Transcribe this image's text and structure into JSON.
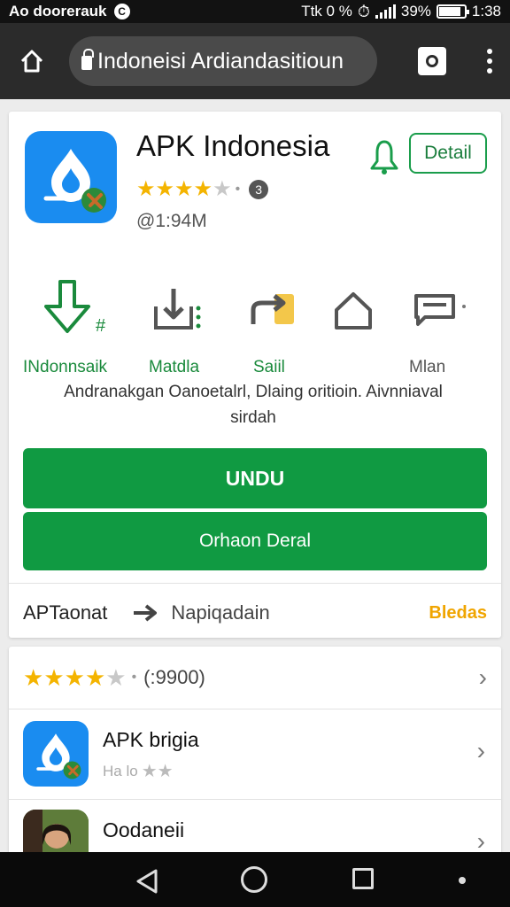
{
  "status_bar": {
    "left_text": "Ao doorerauk",
    "left_icon": "C",
    "right_text": "Ttk 0 %",
    "battery_percent": "39%",
    "time": "1:38"
  },
  "browser": {
    "url": "Indoneisi Ardiandasitioun"
  },
  "app": {
    "title": "APK Indonesia",
    "rating_stars": 3.5,
    "rating_badge": "3",
    "size": "@1:94M",
    "detail_button": "Detail",
    "accent_color": "#109a42",
    "icon_color": "#1a8cf0"
  },
  "features": [
    {
      "icon": "download-icon",
      "label": "INdonnsaik",
      "color": "#1a8a3c"
    },
    {
      "icon": "install-icon",
      "label": "Matdla",
      "color": "#1a8a3c"
    },
    {
      "icon": "share-icon",
      "label": "Saiil",
      "color": "#1a8a3c"
    },
    {
      "icon": "home-outline-icon",
      "label": "",
      "color": "#555555"
    },
    {
      "icon": "message-icon",
      "label": "Mlan",
      "color": "#555555"
    }
  ],
  "description": {
    "line1": "Andranakgan Oanoetalrl, Dlaing oritioin. Aivnniaval",
    "line2": "sirdah"
  },
  "buttons": {
    "primary": "UNDU",
    "secondary": "Orhaon Deral"
  },
  "bottom_bar": {
    "left": "APTaonat",
    "middle": "Napiqadain",
    "right": "Bledas",
    "right_color": "#f0a500"
  },
  "reviews": {
    "stars": 3.5,
    "count": "(:9900)"
  },
  "list": [
    {
      "name": "APK brigia",
      "sub": "Ha lo",
      "stars": 2
    },
    {
      "name": "Oodaneii",
      "sub": ""
    }
  ]
}
